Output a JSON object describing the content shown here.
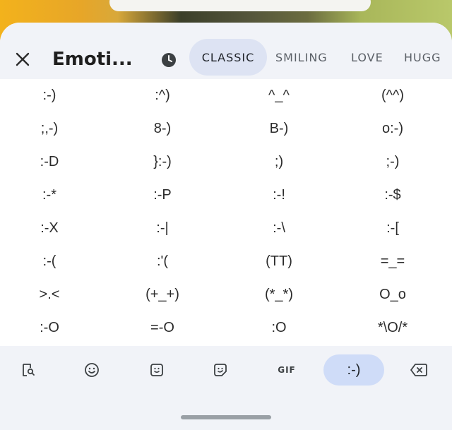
{
  "header": {
    "title": "Emoti...",
    "tabs": [
      {
        "label": "CLASSIC",
        "active": true
      },
      {
        "label": "SMILING",
        "active": false
      },
      {
        "label": "LOVE",
        "active": false
      },
      {
        "label": "HUGG",
        "active": false
      }
    ],
    "icons": {
      "close": "close-icon",
      "recent": "clock-icon"
    }
  },
  "emoticons": [
    [
      ":-)",
      ":^)",
      "^_^",
      "(^^)"
    ],
    [
      ";,-)",
      "8-)",
      "B-)",
      "o:-)"
    ],
    [
      ":-D",
      "}:-)",
      ";)",
      ";-)"
    ],
    [
      ":-*",
      ":-P",
      ":-!",
      ":-$"
    ],
    [
      ":-X",
      ":-|",
      ":-\\",
      ":-["
    ],
    [
      ":-(",
      ":'(",
      "(TT)",
      "=_="
    ],
    [
      ">.<",
      "(+_+)",
      "(*_*)",
      "O_o"
    ],
    [
      ":-O",
      "=-O",
      ":O",
      "*\\O/*"
    ]
  ],
  "toolbar": {
    "gif_label": "GIF",
    "emoticon_label": ":-)",
    "icons": [
      "clipboard-search-icon",
      "emoji-icon",
      "sticker-icon",
      "emoji-kitchen-icon",
      "gif-icon",
      "emoticon-icon",
      "backspace-icon"
    ]
  },
  "colors": {
    "header_bg": "#f1f3f8",
    "active_tab_bg": "#dde3f3",
    "active_toolbar_bg": "#cfdcf8"
  }
}
